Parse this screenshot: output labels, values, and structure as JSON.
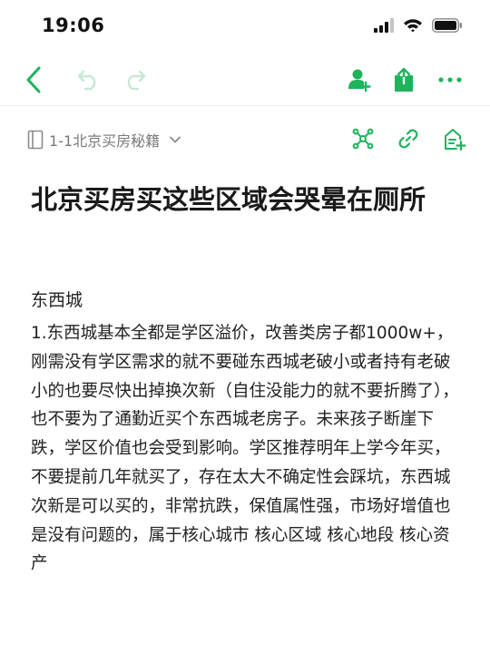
{
  "status_bar": {
    "time": "19:06",
    "icons": [
      "cellular-signal-icon",
      "wifi-icon",
      "battery-icon"
    ]
  },
  "toolbar": {
    "icons": [
      "back-icon",
      "undo-icon",
      "redo-icon",
      "add-collaborator-icon",
      "share-icon",
      "more-icon"
    ],
    "accent_color": "#1fb35c",
    "disabled_color": "#c6e8d3"
  },
  "doc_header": {
    "breadcrumb": "1-1北京买房秘籍",
    "icons": [
      "document-icon",
      "chevron-down-icon",
      "mind-map-icon",
      "link-icon",
      "add-page-icon"
    ]
  },
  "article": {
    "title": "北京买房买这些区域会哭晕在厕所",
    "section_heading": "东西城",
    "body": "1.东西城基本全都是学区溢价，改善类房子都1000w+，刚需没有学区需求的就不要碰东西城老破小或者持有老破小的也要尽快出掉换次新（自住没能力的就不要折腾了），也不要为了通勤近买个东西城老房子。未来孩子断崖下跌，学区价值也会受到影响。学区推荐明年上学今年买，不要提前几年就买了，存在太大不确定性会踩坑，东西城次新是可以买的，非常抗跌，保值属性强，市场好增值也是没有问题的，属于核心城市 核心区域 核心地段 核心资产"
  }
}
